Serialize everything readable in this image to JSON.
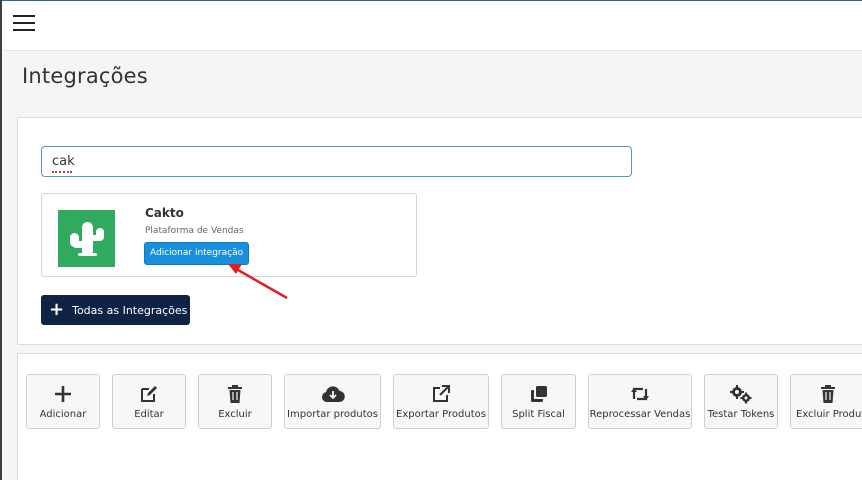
{
  "header": {
    "menu_icon": "hamburger-menu-icon"
  },
  "page": {
    "title": "Integrações"
  },
  "search": {
    "value": "cak"
  },
  "card": {
    "name": "Cakto",
    "subtitle": "Plataforma de Vendas",
    "add_label": "Adicionar integração",
    "logo_icon": "cactus-icon",
    "logo_color": "#2faa5e"
  },
  "all_integrations": {
    "label": "Todas as Integrações",
    "icon": "plus-icon"
  },
  "toolbar": {
    "items": [
      {
        "label": "Adicionar",
        "icon": "plus-icon"
      },
      {
        "label": "Editar",
        "icon": "edit-icon"
      },
      {
        "label": "Excluir",
        "icon": "trash-icon"
      },
      {
        "label": "Importar produtos",
        "icon": "cloud-download-icon"
      },
      {
        "label": "Exportar Produtos",
        "icon": "external-link-icon"
      },
      {
        "label": "Split Fiscal",
        "icon": "clone-icon"
      },
      {
        "label": "Reprocessar Vendas",
        "icon": "retweet-icon"
      },
      {
        "label": "Testar Tokens",
        "icon": "gears-icon"
      },
      {
        "label": "Excluir Produtos",
        "icon": "trash-icon"
      }
    ]
  },
  "colors": {
    "accent": "#1a8fdb",
    "dark_button": "#0f2444",
    "annotation_arrow": "#e02020"
  }
}
